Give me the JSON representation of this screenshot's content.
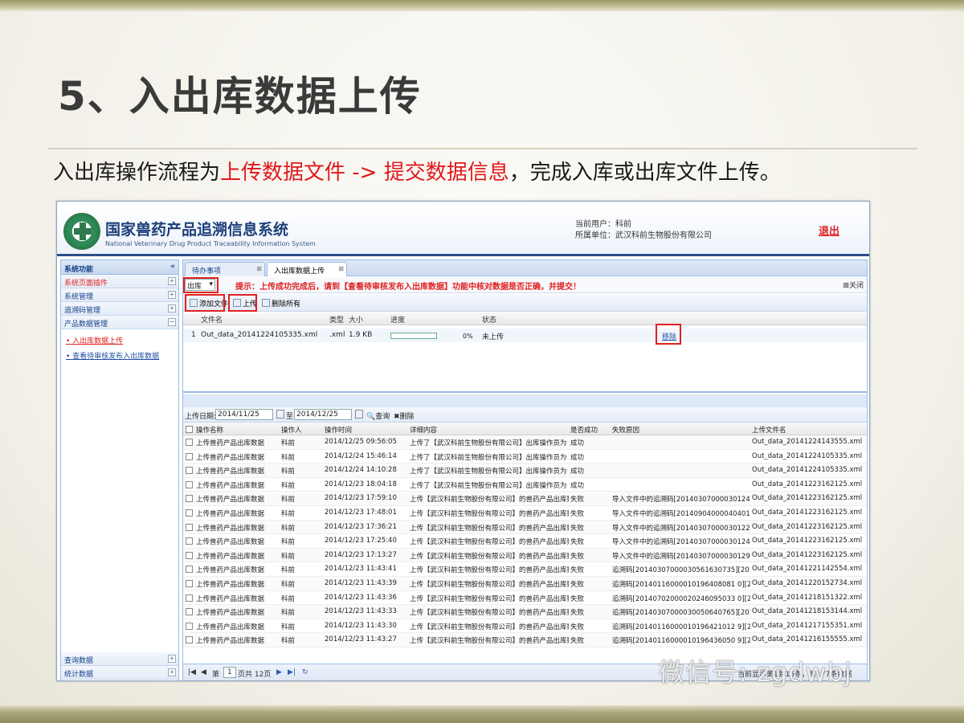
{
  "slide": {
    "title": "5、入出库数据上传",
    "subtitle_pre": "入出库操作流程为",
    "subtitle_red": "上传数据文件 -> 提交数据信息",
    "subtitle_post": "，完成入库或出库文件上传。"
  },
  "app": {
    "title": "国家兽药产品追溯信息系统",
    "subtitle": "National Veterinary Drug Product Traceability Information System",
    "current_user": "当前用户：科前",
    "org": "所属单位：武汉科前生物股份有限公司",
    "logout": "退出"
  },
  "sidebar": {
    "header": "系统功能",
    "collapse": "«",
    "items": [
      "系统页面插件",
      "系统管理",
      "追溯码管理",
      "产品数据管理"
    ],
    "links": [
      "入出库数据上传",
      "查看待审核发布入出库数据"
    ],
    "bottom_items": [
      "查询数据",
      "统计数据"
    ]
  },
  "tabs": [
    "待办事项",
    "入出库数据上传"
  ],
  "toolbar": {
    "direction": "出库",
    "hint": "提示：上传成功完成后，请到【查看待审核发布入出库数据】功能中核对数据是否正确，并提交！",
    "close": "关闭",
    "add_file": "添加文件",
    "upload": "上传",
    "delete_all": "删除所有"
  },
  "upload_grid": {
    "columns": [
      "文件名",
      "类型",
      "大小",
      "进度",
      "状态"
    ],
    "row": {
      "index": "1",
      "filename": "Out_data_20141224105335.xml",
      "type": ".xml",
      "size": "1.9 KB",
      "progress_percent": 0,
      "progress_text": "0%",
      "status": "未上传",
      "action": "移除"
    }
  },
  "filter": {
    "date_label": "上传日期:",
    "date_from": "2014/11/25",
    "to_label": "至",
    "date_to": "2014/12/25",
    "query": "查询",
    "delete": "删除"
  },
  "log_grid": {
    "columns": [
      "操作名称",
      "操作人",
      "操作时间",
      "详细内容",
      "是否成功",
      "失败原因",
      "上传文件名"
    ],
    "rows": [
      [
        "上传兽药产品出库数据",
        "科前",
        "2014/12/25 09:56:05",
        "上传了【武汉科前生物股份有限公司】出库操作员为【...",
        "成功",
        "",
        "Out_data_20141224143555.xml"
      ],
      [
        "上传兽药产品出库数据",
        "科前",
        "2014/12/24 15:46:14",
        "上传了【武汉科前生物股份有限公司】出库操作员为【...",
        "成功",
        "",
        "Out_data_20141224105335.xml"
      ],
      [
        "上传兽药产品出库数据",
        "科前",
        "2014/12/24 14:10:28",
        "上传了【武汉科前生物股份有限公司】出库操作员为【...",
        "成功",
        "",
        "Out_data_20141224105335.xml"
      ],
      [
        "上传兽药产品出库数据",
        "科前",
        "2014/12/23 18:04:18",
        "上传了【武汉科前生物股份有限公司】出库操作员为【...",
        "成功",
        "",
        "Out_data_20141223162125.xml"
      ],
      [
        "上传兽药产品出库数据",
        "科前",
        "2014/12/23 17:59:10",
        "上传【武汉科前生物股份有限公司】的兽药产品出库数...",
        "失败",
        "导入文件中的追溯码[20140307000030124079...",
        "Out_data_20141223162125.xml"
      ],
      [
        "上传兽药产品出库数据",
        "科前",
        "2014/12/23 17:48:01",
        "上传【武汉科前生物股份有限公司】的兽药产品出库数...",
        "失败",
        "导入文件中的追溯码[20140904000040401751...",
        "Out_data_20141223162125.xml"
      ],
      [
        "上传兽药产品出库数据",
        "科前",
        "2014/12/23 17:36:21",
        "上传【武汉科前生物股份有限公司】的兽药产品出库数...",
        "失败",
        "导入文件中的追溯码[20140307000030122955...",
        "Out_data_20141223162125.xml"
      ],
      [
        "上传兽药产品出库数据",
        "科前",
        "2014/12/23 17:25:40",
        "上传【武汉科前生物股份有限公司】的兽药产品出库数...",
        "失败",
        "导入文件中的追溯码[20140307000030124063...",
        "Out_data_20141223162125.xml"
      ],
      [
        "上传兽药产品出库数据",
        "科前",
        "2014/12/23 17:13:27",
        "上传【武汉科前生物股份有限公司】的兽药产品出库数...",
        "失败",
        "导入文件中的追溯码[20140307000030129978...",
        "Out_data_20141223162125.xml"
      ],
      [
        "上传兽药产品出库数据",
        "科前",
        "2014/12/23 11:43:41",
        "上传【武汉科前生物股份有限公司】的兽药产品出库数...",
        "失败",
        "追溯码[20140307000030561630735][201403...",
        "Out_data_20141221142554.xml"
      ],
      [
        "上传兽药产品出库数据",
        "科前",
        "2014/12/23 11:43:39",
        "上传【武汉科前生物股份有限公司】的兽药产品出库数...",
        "失败",
        "追溯码[20140116000010196408081 0][201401...",
        "Out_data_20141220152734.xml"
      ],
      [
        "上传兽药产品出库数据",
        "科前",
        "2014/12/23 11:43:36",
        "上传【武汉科前生物股份有限公司】的兽药产品出库数...",
        "失败",
        "追溯码[20140702000020246095033 0][201407...",
        "Out_data_20141218151322.xml"
      ],
      [
        "上传兽药产品出库数据",
        "科前",
        "2014/12/23 11:43:33",
        "上传【武汉科前生物股份有限公司】的兽药产品出库数...",
        "失败",
        "追溯码[20140307000030050640765][201403...",
        "Out_data_20141218153144.xml"
      ],
      [
        "上传兽药产品出库数据",
        "科前",
        "2014/12/23 11:43:30",
        "上传【武汉科前生物股份有限公司】的兽药产品出库数...",
        "失败",
        "追溯码[20140116000010196421012 9][201401...",
        "Out_data_20141217155351.xml"
      ],
      [
        "上传兽药产品出库数据",
        "科前",
        "2014/12/23 11:43:27",
        "上传【武汉科前生物股份有限公司】的兽药产品出库数...",
        "失败",
        "追溯码[20140116000010196436050 9][201401...",
        "Out_data_20141216155555.xml"
      ]
    ]
  },
  "pager": {
    "page_label": "第",
    "page": "1",
    "total": "页共 12页",
    "summary": "当前显示第1到15条，共177条数据"
  },
  "watermark": "微信号: zgdwbj"
}
